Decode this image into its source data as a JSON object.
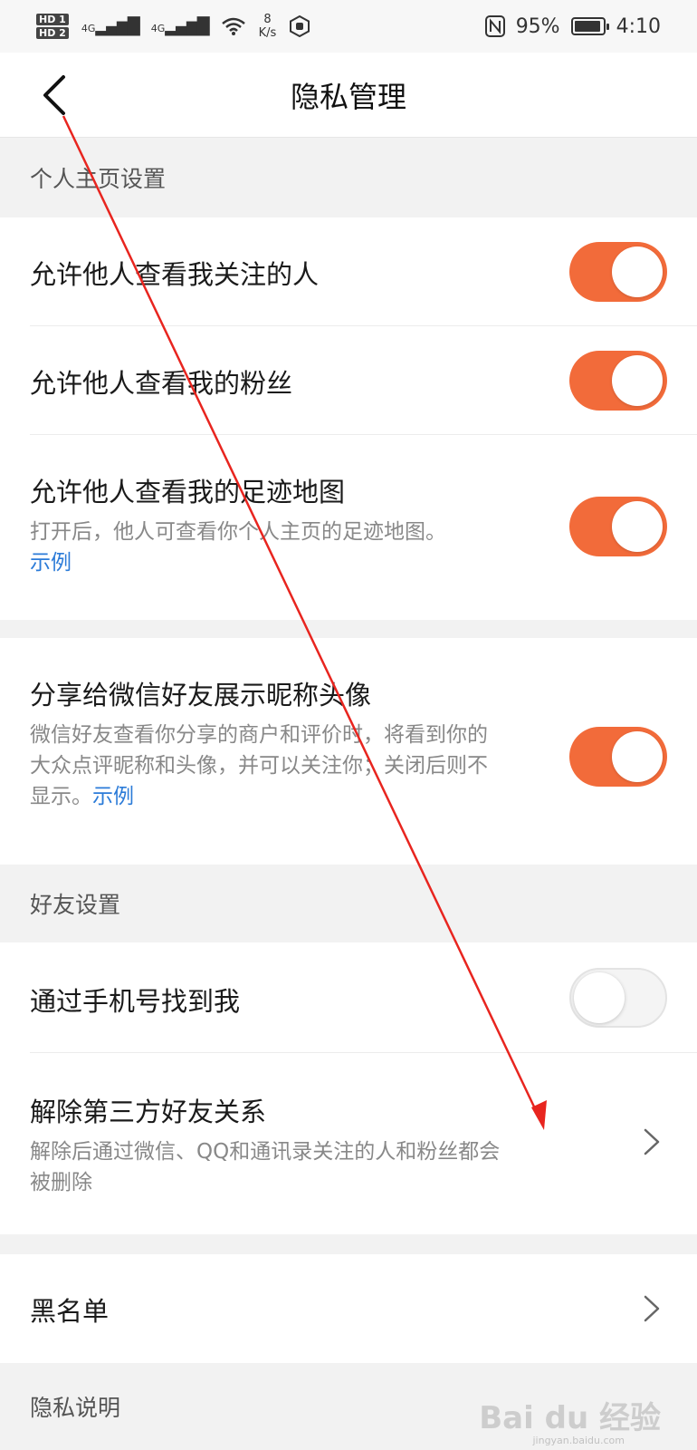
{
  "status_bar": {
    "hd1": "HD 1",
    "hd2": "HD 2",
    "signal1": "4G",
    "signal2": "4G",
    "speed_value": "8",
    "speed_unit": "K/s",
    "battery": "95%",
    "time": "4:10"
  },
  "header": {
    "title": "隐私管理"
  },
  "sections": {
    "profile": "个人主页设置",
    "friends": "好友设置",
    "privacy": "隐私说明"
  },
  "settings": {
    "view_following": {
      "title": "允许他人查看我关注的人",
      "enabled": true
    },
    "view_fans": {
      "title": "允许他人查看我的粉丝",
      "enabled": true
    },
    "view_footprint": {
      "title": "允许他人查看我的足迹地图",
      "desc": "打开后，他人可查看你个人主页的足迹地图。",
      "link": "示例",
      "enabled": true
    },
    "wechat_share": {
      "title": "分享给微信好友展示昵称头像",
      "desc": "微信好友查看你分享的商户和评价时，将看到你的大众点评昵称和头像，并可以关注你；关闭后则不显示。",
      "link": "示例",
      "enabled": true
    },
    "find_by_phone": {
      "title": "通过手机号找到我",
      "enabled": false
    },
    "unbind_third_party": {
      "title": "解除第三方好友关系",
      "desc": "解除后通过微信、QQ和通讯录关注的人和粉丝都会被删除"
    },
    "blacklist": {
      "title": "黑名单"
    }
  },
  "watermark": {
    "brand": "Bai du 经验",
    "url": "jingyan.baidu.com"
  },
  "colors": {
    "toggle_on": "#f26b3a",
    "link": "#2b7bd8",
    "annotation_arrow": "#e8251f"
  }
}
